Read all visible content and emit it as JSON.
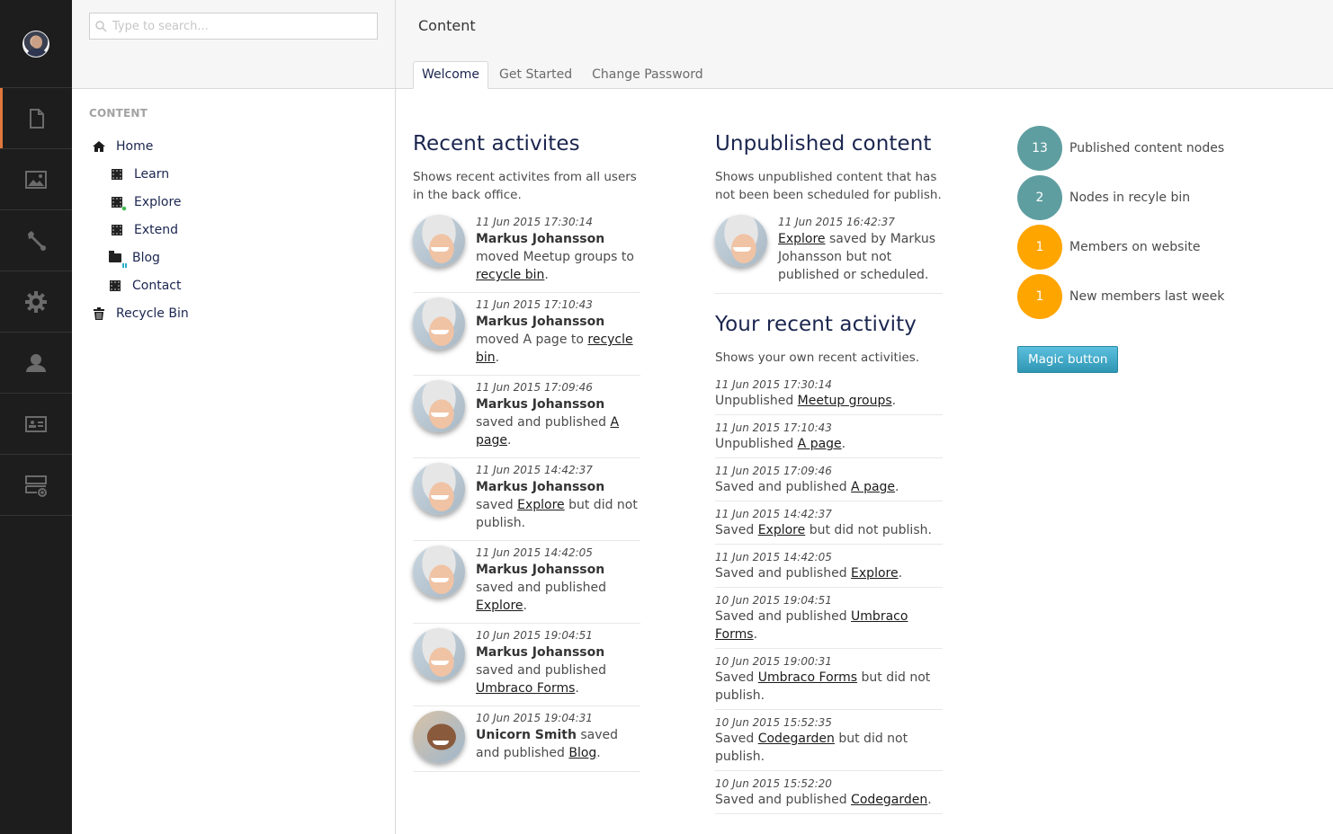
{
  "appbar": {
    "user_avatar": "user-avatar",
    "sections": [
      {
        "name": "content",
        "icon": "document-icon",
        "active": true
      },
      {
        "name": "media",
        "icon": "image-icon",
        "active": false
      },
      {
        "name": "developer",
        "icon": "wrench-icon",
        "active": false
      },
      {
        "name": "settings",
        "icon": "gear-icon",
        "active": false
      },
      {
        "name": "users",
        "icon": "user-icon",
        "active": false
      },
      {
        "name": "members",
        "icon": "id-card-icon",
        "active": false
      },
      {
        "name": "forms",
        "icon": "form-add-icon",
        "active": false
      }
    ]
  },
  "tree": {
    "search_placeholder": "Type to search...",
    "section_title": "CONTENT",
    "items": [
      {
        "label": "Home",
        "icon": "home-icon",
        "level": 0
      },
      {
        "label": "Learn",
        "icon": "document-icon",
        "level": 1
      },
      {
        "label": "Explore",
        "icon": "document-icon",
        "level": 1,
        "badge": "pending-changes"
      },
      {
        "label": "Extend",
        "icon": "document-icon",
        "level": 1
      },
      {
        "label": "Blog",
        "icon": "folder-icon",
        "level": 1,
        "badge": "list-view"
      },
      {
        "label": "Contact",
        "icon": "document-icon",
        "level": 1
      },
      {
        "label": "Recycle Bin",
        "icon": "trash-icon",
        "level": 0
      }
    ]
  },
  "header": {
    "title": "Content",
    "tabs": [
      {
        "label": "Welcome",
        "active": true
      },
      {
        "label": "Get Started",
        "active": false
      },
      {
        "label": "Change Password",
        "active": false
      }
    ]
  },
  "recent": {
    "title": "Recent activites",
    "description": "Shows recent activites from all users in the back office.",
    "items": [
      {
        "timestamp": "11 Jun 2015 17:30:14",
        "user": "Markus Johansson",
        "avatar": "markus",
        "before": " moved Meetup groups to ",
        "link": "recycle bin",
        "after": "."
      },
      {
        "timestamp": "11 Jun 2015 17:10:43",
        "user": "Markus Johansson",
        "avatar": "markus",
        "before": " moved A page to ",
        "link": "recycle bin",
        "after": "."
      },
      {
        "timestamp": "11 Jun 2015 17:09:46",
        "user": "Markus Johansson",
        "avatar": "markus",
        "before": " saved and published ",
        "link": "A page",
        "after": "."
      },
      {
        "timestamp": "11 Jun 2015 14:42:37",
        "user": "Markus Johansson",
        "avatar": "markus",
        "before": " saved ",
        "link": "Explore",
        "after": " but did not publish."
      },
      {
        "timestamp": "11 Jun 2015 14:42:05",
        "user": "Markus Johansson",
        "avatar": "markus",
        "before": " saved and published ",
        "link": "Explore",
        "after": "."
      },
      {
        "timestamp": "10 Jun 2015 19:04:51",
        "user": "Markus Johansson",
        "avatar": "markus",
        "before": " saved and published ",
        "link": "Umbraco Forms",
        "after": "."
      },
      {
        "timestamp": "10 Jun 2015 19:04:31",
        "user": "Unicorn Smith",
        "avatar": "unicorn",
        "before": " saved and published ",
        "link": "Blog",
        "after": "."
      }
    ]
  },
  "unpublished": {
    "title": "Unpublished content",
    "description": "Shows unpublished content that has not been been scheduled for publish.",
    "item": {
      "timestamp": "11 Jun 2015 16:42:37",
      "link": "Explore",
      "after": " saved by Markus Johansson but not published or scheduled."
    }
  },
  "own": {
    "title": "Your recent activity",
    "description": "Shows your own recent activities.",
    "items": [
      {
        "timestamp": "11 Jun 2015 17:30:14",
        "before": "Unpublished ",
        "link": "Meetup groups",
        "after": "."
      },
      {
        "timestamp": "11 Jun 2015 17:10:43",
        "before": "Unpublished ",
        "link": "A page",
        "after": "."
      },
      {
        "timestamp": "11 Jun 2015 17:09:46",
        "before": "Saved and published ",
        "link": "A page",
        "after": "."
      },
      {
        "timestamp": "11 Jun 2015 14:42:37",
        "before": "Saved ",
        "link": "Explore",
        "after": " but did not publish."
      },
      {
        "timestamp": "11 Jun 2015 14:42:05",
        "before": "Saved and published ",
        "link": "Explore",
        "after": "."
      },
      {
        "timestamp": "10 Jun 2015 19:04:51",
        "before": "Saved and published ",
        "link": "Umbraco Forms",
        "after": "."
      },
      {
        "timestamp": "10 Jun 2015 19:00:31",
        "before": "Saved ",
        "link": "Umbraco Forms",
        "after": " but did not publish."
      },
      {
        "timestamp": "10 Jun 2015 15:52:35",
        "before": "Saved ",
        "link": "Codegarden",
        "after": " but did not publish."
      },
      {
        "timestamp": "10 Jun 2015 15:52:20",
        "before": "Saved and published ",
        "link": "Codegarden",
        "after": "."
      }
    ]
  },
  "stats": {
    "items": [
      {
        "value": "13",
        "label": "Published content nodes",
        "color": "#5f9ea0"
      },
      {
        "value": "2",
        "label": "Nodes in recyle bin",
        "color": "#5f9ea0"
      },
      {
        "value": "1",
        "label": "Members on website",
        "color": "#ffa500"
      },
      {
        "value": "1",
        "label": "New members last week",
        "color": "#ffa500"
      }
    ],
    "button_label": "Magic button"
  },
  "colors": {
    "active_section": "#e0773b",
    "sidebar_bg": "#1d1d1d",
    "button": "#2f96b4"
  }
}
